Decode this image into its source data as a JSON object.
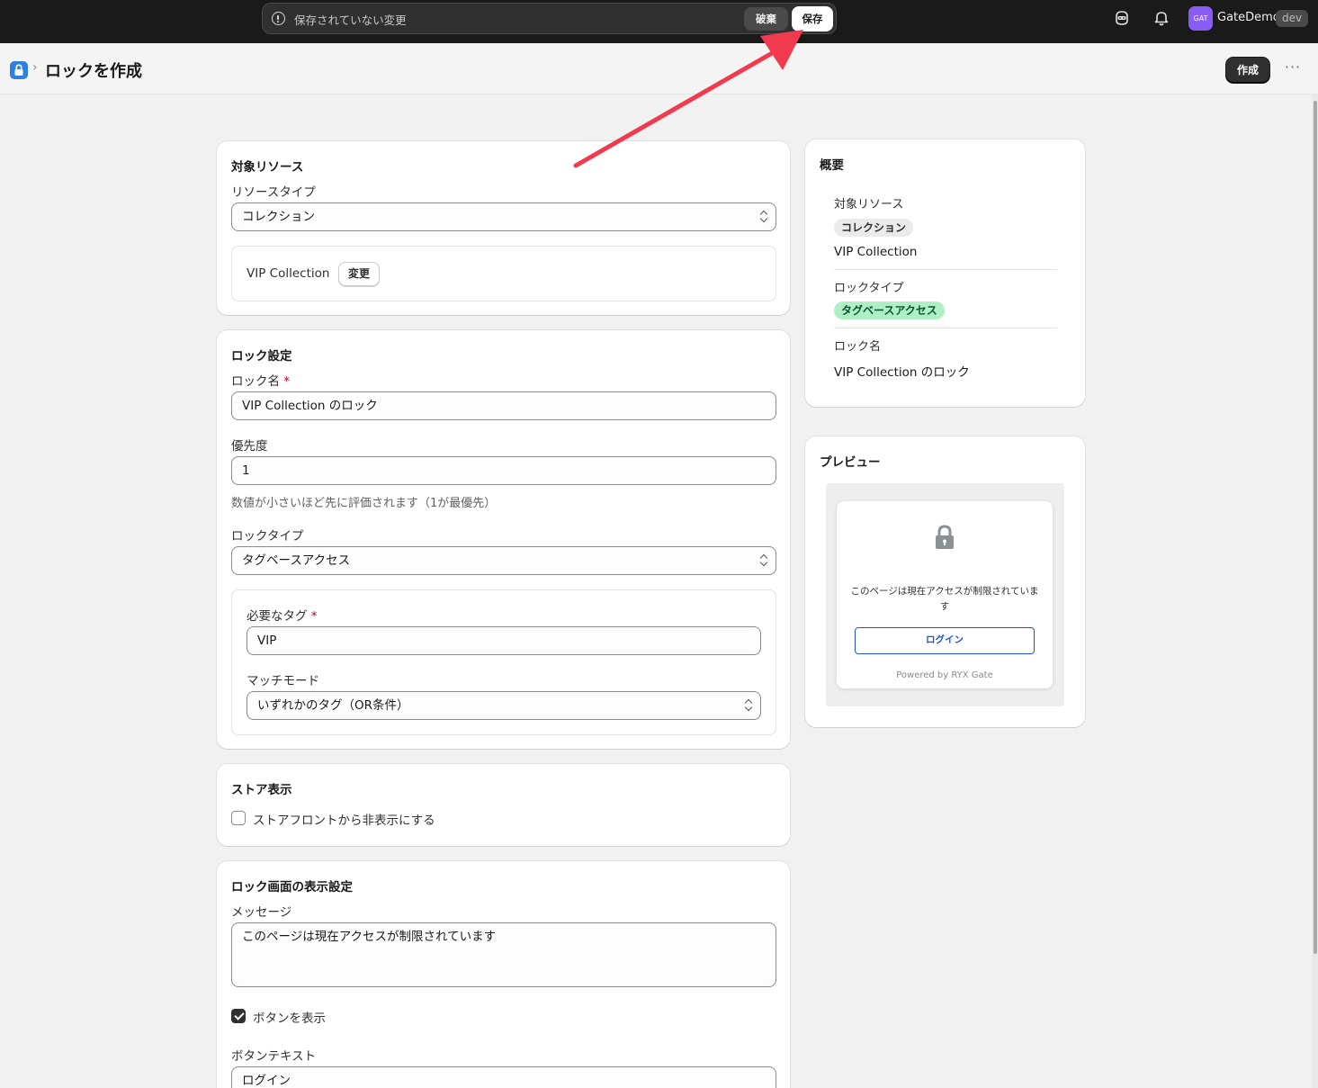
{
  "topbar": {
    "unsaved_text": "保存されていない変更",
    "discard_label": "破棄",
    "save_label": "保存",
    "avatar_text": "GAT",
    "store_name": "GateDemo",
    "store_badge": "dev"
  },
  "header": {
    "title": "ロックを作成",
    "create_label": "作成",
    "more_label": "···"
  },
  "target_resource": {
    "title": "対象リソース",
    "type_label": "リソースタイプ",
    "type_value": "コレクション",
    "selected_name": "VIP Collection",
    "change_label": "変更"
  },
  "lock_settings": {
    "title": "ロック設定",
    "name_label": "ロック名",
    "required_mark": "*",
    "name_value": "VIP Collection のロック",
    "priority_label": "優先度",
    "priority_value": "1",
    "priority_help": "数値が小さいほど先に評価されます（1が最優先）",
    "lock_type_label": "ロックタイプ",
    "lock_type_value": "タグベースアクセス",
    "tags_label": "必要なタグ",
    "tags_value": "VIP",
    "match_label": "マッチモード",
    "match_value": "いずれかのタグ（OR条件）"
  },
  "store_display": {
    "title": "ストア表示",
    "hide_label": "ストアフロントから非表示にする",
    "hide_checked": false
  },
  "lock_screen": {
    "title": "ロック画面の表示設定",
    "message_label": "メッセージ",
    "message_value": "このページは現在アクセスが制限されています",
    "show_button_label": "ボタンを表示",
    "show_button_checked": true,
    "button_text_label": "ボタンテキスト",
    "button_text_value": "ログイン"
  },
  "summary": {
    "title": "概要",
    "resource_label": "対象リソース",
    "resource_tag": "コレクション",
    "resource_name": "VIP Collection",
    "lock_type_label": "ロックタイプ",
    "lock_type_tag": "タグベースアクセス",
    "lock_name_label": "ロック名",
    "lock_name_value": "VIP Collection のロック"
  },
  "preview": {
    "title": "プレビュー",
    "message": "このページは現在アクセスが制限されています",
    "button_label": "ログイン",
    "powered_by": "Powered by RYX Gate"
  },
  "colors": {
    "topbar_bg": "#1a1a1a",
    "accent_green_tag": "#aef0c4",
    "preview_button": "#1f55d2",
    "annotation_arrow": "#f23a4e"
  }
}
